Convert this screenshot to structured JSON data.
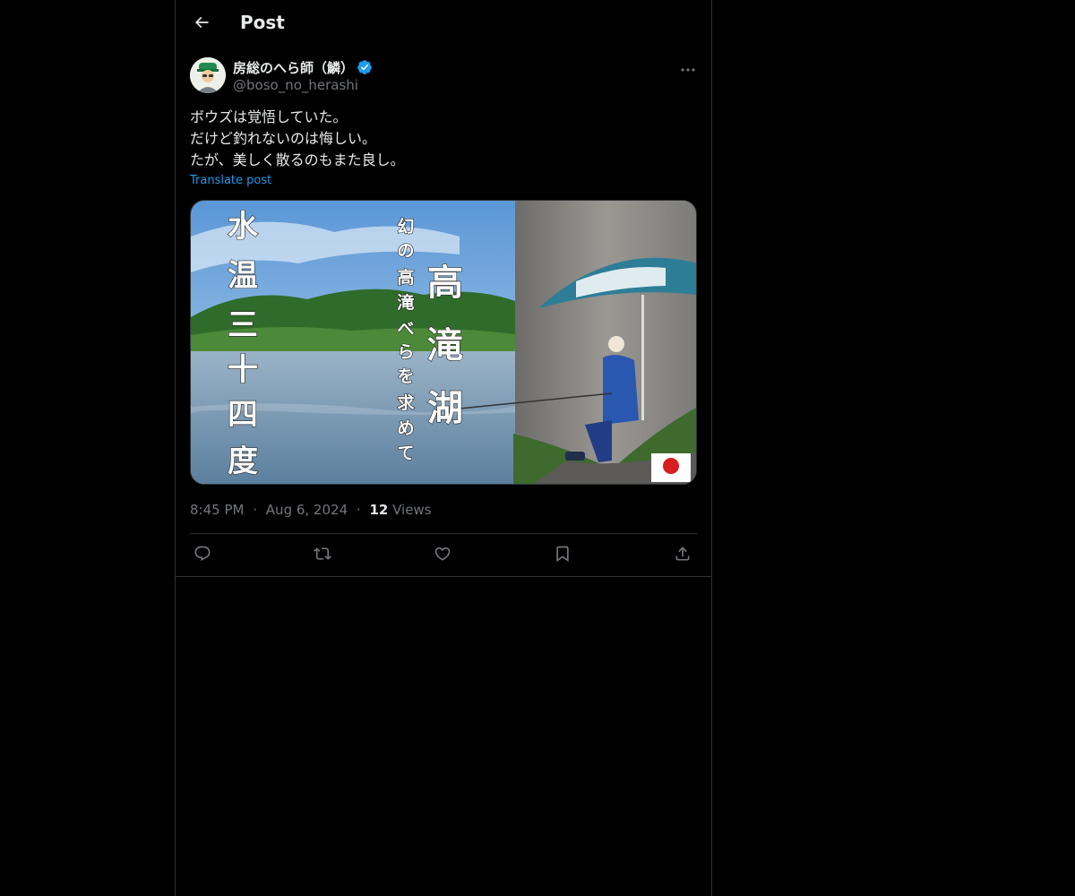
{
  "header": {
    "title": "Post"
  },
  "post": {
    "author": {
      "display_name": "房総のへら師（鱗）",
      "handle": "@boso_no_herashi",
      "verified": true
    },
    "text_lines": [
      "ボウズは覚悟していた。",
      "だけど釣れないのは悔しい。",
      "たが、美しく散るのもまた良し。"
    ],
    "translate_label": "Translate post",
    "media": {
      "overlay_text_left": "水温三十四度",
      "overlay_text_mid": "幻の高滝べらを求めて",
      "overlay_text_right": "高滝湖"
    },
    "time": "8:45 PM",
    "date": "Aug 6, 2024",
    "views_count": "12",
    "views_label": "Views"
  },
  "icons": {
    "back": "arrow-left-icon",
    "more": "more-horizontal-icon",
    "reply": "reply-icon",
    "repost": "repost-icon",
    "like": "heart-icon",
    "bookmark": "bookmark-icon",
    "share": "share-icon"
  },
  "colors": {
    "background": "#000000",
    "text": "#e7e9ea",
    "secondary": "#71767b",
    "accent": "#1d9bf0",
    "border": "#2f3336"
  }
}
